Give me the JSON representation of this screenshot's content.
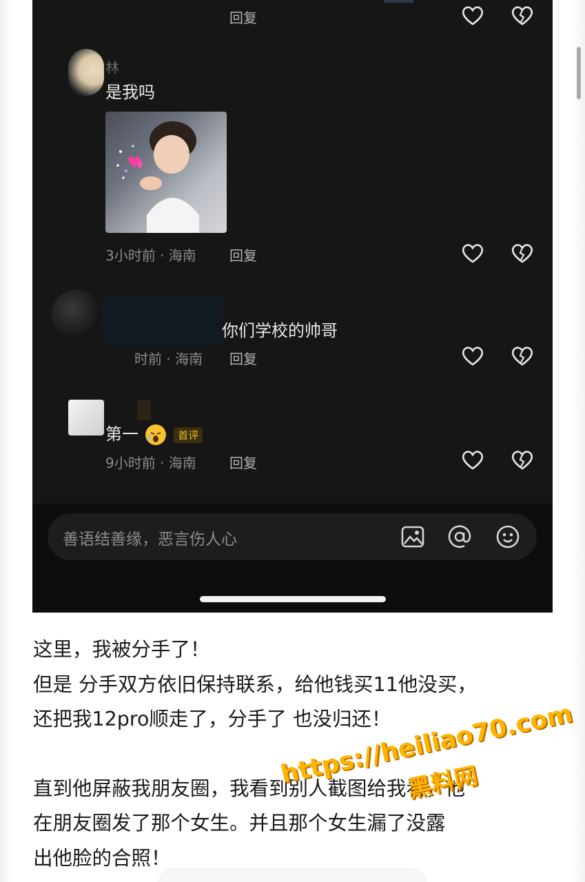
{
  "comments": [
    {
      "time": "",
      "reply_label": "回复",
      "username": "",
      "text": ""
    },
    {
      "username": "林",
      "text": "是我吗",
      "time": "3小时前 · 海南",
      "reply_label": "回复"
    },
    {
      "username": "",
      "text": "你们学校的帅哥",
      "time": "时前 · 海南",
      "reply_label": "回复"
    },
    {
      "username": "",
      "text": "第一",
      "badge": "首评",
      "time": "9小时前 · 海南",
      "reply_label": "回复"
    }
  ],
  "comment_input": {
    "placeholder": "善语结善缘，恶言伤人心",
    "icons": [
      "image-icon",
      "at-icon",
      "emoji-icon"
    ]
  },
  "article": {
    "paragraph1_lines": [
      "这里，我被分手了！",
      "但是 分手双方依旧保持联系，给他钱买11他没买，",
      "还把我12pro顺走了，分手了 也没归还！"
    ],
    "paragraph2_lines": [
      "直到他屏蔽我朋友圈，我看到别人截图给我看，他",
      "在朋友圈发了那个女生。并且那个女生漏了没露",
      "出他脸的合照！"
    ]
  },
  "watermark": {
    "url": "https://heiliao70.com",
    "name": "黑料网"
  },
  "colors": {
    "phone_bg": "#161616",
    "input_bg": "#1d1d1d",
    "badge": "#e8b92e",
    "watermark": "#ffb400"
  }
}
